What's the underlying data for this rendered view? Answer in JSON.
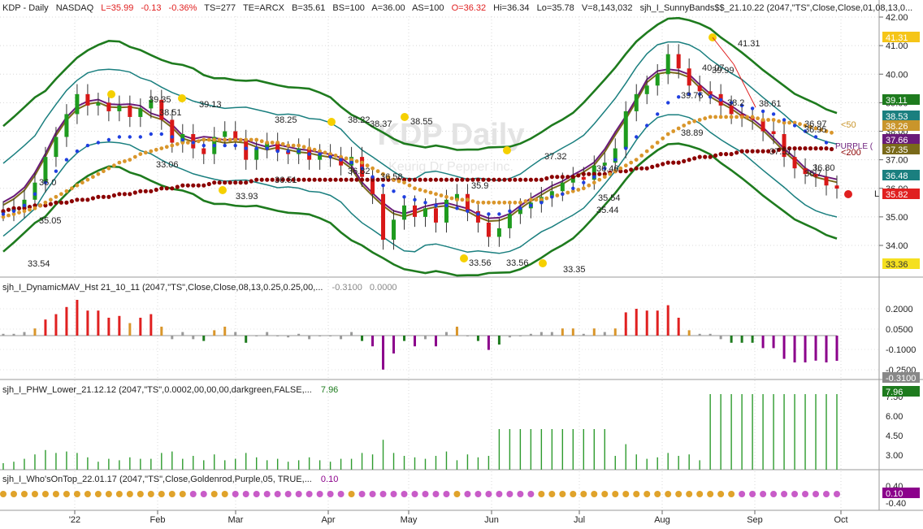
{
  "header": {
    "symbol": "KDP - Daily",
    "exchange": "NASDAQ",
    "last": "L=35.99",
    "change": "-0.13",
    "pct": "-0.36%",
    "ts": "TS=277",
    "te": "TE=ARCX",
    "bid": "B=35.61",
    "bs": "BS=100",
    "ask": "A=36.00",
    "as": "AS=100",
    "open": "O=36.32",
    "high": "Hi=36.34",
    "low": "Lo=35.78",
    "vol": "V=8,143,032",
    "study": "sjh_I_SunnyBands$$_21.10.22 (2047,\"TS\",Close,Close,01,08,13,0..."
  },
  "watermark": {
    "title": "KDP Daily",
    "subtitle": "Keurig Dr Pepper Inc."
  },
  "panels": {
    "dmav": {
      "label": "sjh_I_DynamicMAV_Hst 21_10_11 (2047,\"TS\",Close,Close,08,13,0.25,0.25,00,...",
      "v1": "-0.3100",
      "v2": "0.0000"
    },
    "phw": {
      "label": "sjh_I_PHW_Lower_21.12.12 (2047,\"TS\",0.0002,00,00,00,darkgreen,FALSE,...",
      "v1": "7.96"
    },
    "who": {
      "label": "sjh_I_Who'sOnTop_22.01.17 (2047,\"TS\",Close,Goldenrod,Purple,05, TRUE,...",
      "v1": "0.10"
    }
  },
  "price_axis": {
    "ticks": [
      "42.00",
      "41.00",
      "40.00",
      "39.00",
      "38.00",
      "37.00",
      "36.00",
      "35.00",
      "34.00"
    ]
  },
  "dmav_axis": {
    "ticks": [
      "0.2000",
      "0.0500",
      "-0.1000",
      "-0.2500"
    ]
  },
  "phw_axis": {
    "ticks": [
      "7.50",
      "6.00",
      "4.50",
      "3.00"
    ]
  },
  "who_axis": {
    "ticks": [
      "0.40",
      "-0.40"
    ]
  },
  "x_axis": {
    "labels": [
      "'22",
      "Feb",
      "Mar",
      "Apr",
      "May",
      "Jun",
      "Jul",
      "Aug",
      "Sep",
      "Oct"
    ]
  },
  "badges": [
    {
      "text": "41.31",
      "color": "#f5c518",
      "tcolor": "#ffffff"
    },
    {
      "text": "39.11",
      "color": "#1e7b1e",
      "tcolor": "#ffffff"
    },
    {
      "text": "38.53",
      "color": "#1a7f7f",
      "tcolor": "#ffffff"
    },
    {
      "text": "38.26",
      "color": "#c9952b",
      "tcolor": "#ffffff"
    },
    {
      "text": "37.66",
      "color": "#6a1b7a",
      "tcolor": "#ffffff"
    },
    {
      "text": "37.35",
      "color": "#7a6a1a",
      "tcolor": "#ffffff"
    },
    {
      "text": "36.48",
      "color": "#1a7f7f",
      "tcolor": "#ffffff"
    },
    {
      "text": "35.82",
      "color": "#e02020",
      "tcolor": "#ffffff"
    },
    {
      "text": "33.36",
      "color": "#f5e020",
      "tcolor": "#333333"
    },
    {
      "text": "-0.3100",
      "color": "#888888",
      "tcolor": "#ffffff"
    },
    {
      "text": "7.96",
      "color": "#1e7b1e",
      "tcolor": "#ffffff"
    },
    {
      "text": "0.10",
      "color": "#8b008b",
      "tcolor": "#ffffff"
    }
  ],
  "right_text": {
    "lt50": "<50",
    "purple": "PURPLE (",
    "lt200": "<200",
    "l": "L"
  },
  "chart_data": {
    "type": "line",
    "x_labels": [
      "'22",
      "Feb",
      "Mar",
      "Apr",
      "May",
      "Jun",
      "Jul",
      "Aug",
      "Sep",
      "Oct"
    ],
    "ylim": [
      33.0,
      42.3
    ],
    "series": [
      {
        "values": [
          35.2,
          35.3,
          35.6,
          36.2,
          37.1,
          37.8,
          38.6,
          39.3,
          38.9,
          39.0,
          38.7,
          38.9,
          38.5,
          38.8,
          39.1,
          38.4,
          37.6,
          37.9,
          37.4,
          37.2,
          37.8,
          38.0,
          37.7,
          37.0,
          37.4,
          37.6,
          37.3,
          37.2,
          37.4,
          37.0,
          37.2,
          37.1,
          36.8,
          37.1,
          36.4,
          35.8,
          34.2,
          34.9,
          35.4,
          35.0,
          35.3,
          34.8,
          35.6,
          35.8,
          35.2,
          34.8,
          34.3,
          34.6,
          35.1,
          35.3,
          35.5,
          35.7,
          35.9,
          36.2,
          36.4,
          36.3,
          36.8,
          36.9,
          37.4,
          38.7,
          39.3,
          39.6,
          40.0,
          40.7,
          40.2,
          39.6,
          39.4,
          39.3,
          38.9,
          38.6,
          38.5,
          38.4,
          38.0,
          37.9,
          37.1,
          36.7,
          36.5,
          36.4,
          36.1,
          35.99
        ]
      },
      {
        "values": [
          35.1,
          35.2,
          35.4,
          35.8,
          36.2,
          36.6,
          37.0,
          37.3,
          37.5,
          37.6,
          37.7,
          37.8,
          37.8,
          37.8,
          37.9,
          37.9,
          37.8,
          37.7,
          37.6,
          37.5,
          37.5,
          37.5,
          37.5,
          37.4,
          37.4,
          37.4,
          37.3,
          37.3,
          37.3,
          37.2,
          37.2,
          37.1,
          37.0,
          36.9,
          36.7,
          36.4,
          36.1,
          35.9,
          35.7,
          35.6,
          35.5,
          35.4,
          35.4,
          35.3,
          35.2,
          35.1,
          35.1,
          35.1,
          35.2,
          35.3,
          35.4,
          35.5,
          35.7,
          35.8,
          36.0,
          36.2,
          36.4,
          36.7,
          37.0,
          37.4,
          37.8,
          38.2,
          38.6,
          39.0,
          39.2,
          39.3,
          39.3,
          39.2,
          39.1,
          39.0,
          38.9,
          38.8,
          38.7,
          38.6,
          38.4,
          38.2,
          38.0,
          37.8,
          37.6,
          37.4
        ]
      },
      {
        "values": [
          35.0,
          35.1,
          35.2,
          35.3,
          35.5,
          35.7,
          35.9,
          36.1,
          36.3,
          36.5,
          36.7,
          36.9,
          37.0,
          37.2,
          37.3,
          37.4,
          37.5,
          37.6,
          37.6,
          37.7,
          37.7,
          37.7,
          37.7,
          37.7,
          37.7,
          37.6,
          37.6,
          37.5,
          37.5,
          37.4,
          37.3,
          37.2,
          37.1,
          37.0,
          36.9,
          36.7,
          36.5,
          36.3,
          36.2,
          36.0,
          35.9,
          35.8,
          35.7,
          35.6,
          35.6,
          35.5,
          35.5,
          35.5,
          35.5,
          35.5,
          35.6,
          35.6,
          35.7,
          35.8,
          35.9,
          36.0,
          36.2,
          36.4,
          36.6,
          36.8,
          37.0,
          37.3,
          37.6,
          37.9,
          38.1,
          38.3,
          38.4,
          38.5,
          38.5,
          38.5,
          38.5,
          38.5,
          38.4,
          38.4,
          38.3,
          38.3,
          38.2,
          38.1,
          38.0,
          37.9
        ]
      },
      {
        "values": [
          35.2,
          35.3,
          35.3,
          35.4,
          35.4,
          35.5,
          35.5,
          35.6,
          35.6,
          35.7,
          35.7,
          35.8,
          35.8,
          35.9,
          35.9,
          36.0,
          36.0,
          36.1,
          36.1,
          36.1,
          36.2,
          36.2,
          36.2,
          36.2,
          36.3,
          36.3,
          36.3,
          36.3,
          36.3,
          36.3,
          36.3,
          36.3,
          36.3,
          36.3,
          36.3,
          36.3,
          36.3,
          36.3,
          36.3,
          36.3,
          36.3,
          36.3,
          36.3,
          36.3,
          36.3,
          36.3,
          36.3,
          36.3,
          36.3,
          36.3,
          36.3,
          36.3,
          36.4,
          36.4,
          36.4,
          36.5,
          36.5,
          36.5,
          36.6,
          36.6,
          36.7,
          36.7,
          36.8,
          36.9,
          36.9,
          37.0,
          37.1,
          37.1,
          37.2,
          37.2,
          37.3,
          37.3,
          37.3,
          37.3,
          37.4,
          37.4,
          37.4,
          37.4,
          37.4,
          37.35
        ]
      }
    ],
    "annotations": [
      "33.54",
      "35.05",
      "36.0",
      "39.35",
      "39.13",
      "38.51",
      "33.06",
      "38.25",
      "36.51",
      "33.93",
      "38.22",
      "36.82",
      "38.37",
      "36.58",
      "38.55",
      "35.9",
      "37.32",
      "33.56",
      "33.56",
      "33.35",
      "36.46",
      "35.54",
      "35.44",
      "40.07",
      "41.31",
      "39.99",
      "39.76",
      "38.89",
      "38.2",
      "38.61",
      "37.51",
      "36.97",
      "36.95",
      "36.80",
      "36.7"
    ]
  }
}
